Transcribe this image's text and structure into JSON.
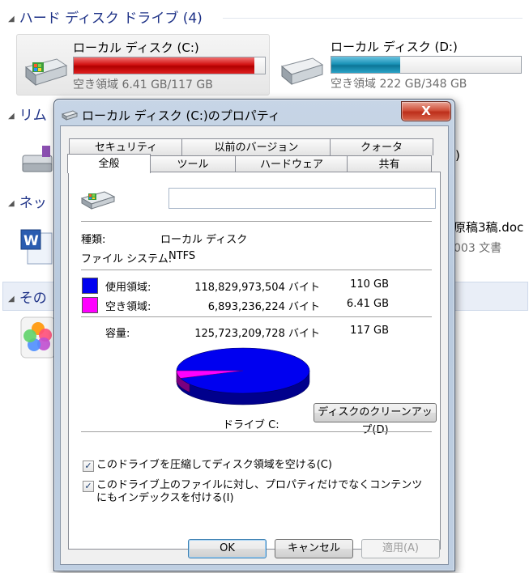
{
  "explorer": {
    "hdd_group": "ハード ディスク ドライブ (4)",
    "removable_group_partial": "リム",
    "network_group_partial": "ネッ",
    "other_group_partial": "その",
    "drives": [
      {
        "name": "ローカル ディスク (C:)",
        "free": "空き領域 6.41 GB/117 GB",
        "used_fraction": 0.945,
        "color": "#c40000"
      },
      {
        "name": "ローカル ディスク (D:)",
        "free": "空き領域 222 GB/348 GB",
        "used_fraction": 0.362,
        "color": "#1b8fb5"
      }
    ],
    "removable_partial_text": ")",
    "network_file_partial": "原稿3稿.doc",
    "network_file_type_partial": "003 文書"
  },
  "dialog": {
    "title": "ローカル ディスク (C:)のプロパティ",
    "close_glyph": "X",
    "tabs_row1": [
      "セキュリティ",
      "以前のバージョン",
      "クォータ"
    ],
    "tabs_row2": [
      "全般",
      "ツール",
      "ハードウェア",
      "共有"
    ],
    "volume_label_value": "",
    "type_label": "種類:",
    "type_value": "ローカル ディスク",
    "fs_label": "ファイル システム:",
    "fs_value": "NTFS",
    "used_label": "使用領域:",
    "used_bytes": "118,829,973,504 バイト",
    "used_size": "110 GB",
    "free_label": "空き領域:",
    "free_bytes": "6,893,236,224 バイト",
    "free_size": "6.41 GB",
    "capacity_label": "容量:",
    "capacity_bytes": "125,723,209,728 バイト",
    "capacity_size": "117 GB",
    "used_color": "#0000f0",
    "free_color": "#ff00ff",
    "free_fraction": 0.0548,
    "drive_caption": "ドライブ C:",
    "cleanup_button": "ディスクのクリーンアップ(D)",
    "compress_checkbox": "このドライブを圧縮してディスク領域を空ける(C)",
    "compress_checked": true,
    "index_checkbox": "このドライブ上のファイルに対し、プロパティだけでなくコンテンツにもインデックスを付ける(I)",
    "index_checked": true,
    "ok_button": "OK",
    "cancel_button": "キャンセル",
    "apply_button": "適用(A)"
  }
}
